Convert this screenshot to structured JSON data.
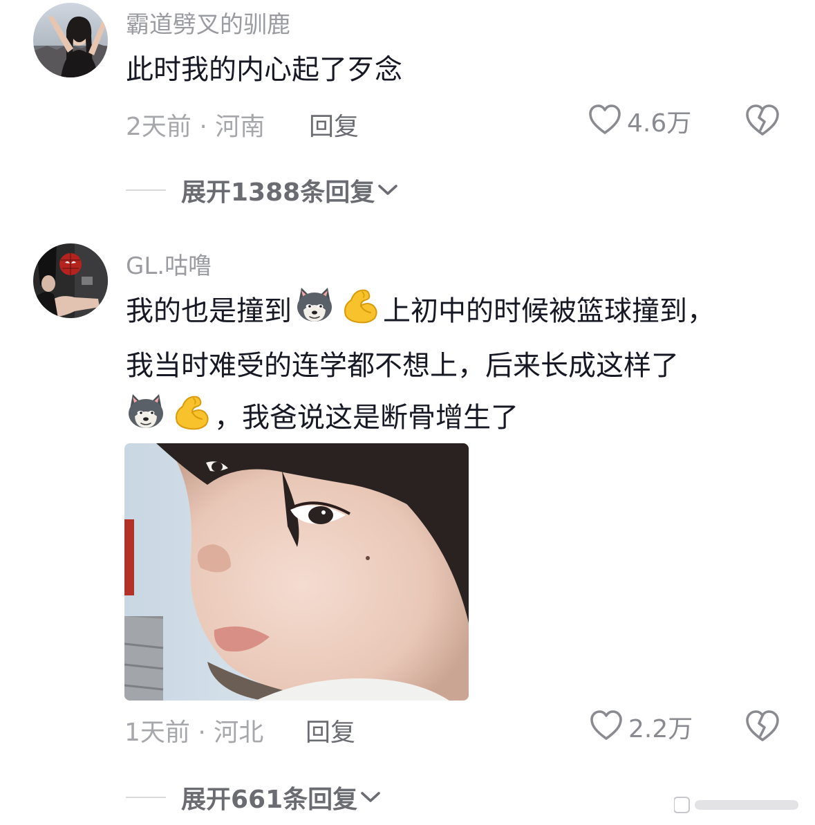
{
  "comments": [
    {
      "username": "霸道劈叉的驯鹿",
      "text_lines": [
        "此时我的内心起了歹念"
      ],
      "time_location": "2天前 · 河南",
      "reply_label": "回复",
      "like_count": "4.6万",
      "expand_label": "展开1388条回复"
    },
    {
      "username": "GL.咕噜",
      "text_line1_before": "我的也是撞到",
      "text_line1_after": "上初中的时候被篮球撞到，",
      "text_line2": "我当时难受的连学都不想上，后来长成这样了",
      "text_line3_after": "，我爸说这是断骨增生了",
      "emojis": [
        "doge-icon",
        "flexed-biceps-icon"
      ],
      "time_location": "1天前 · 河北",
      "reply_label": "回复",
      "like_count": "2.2万",
      "expand_label": "展开661条回复"
    }
  ],
  "colors": {
    "username": "#9a9ba0",
    "body_text": "#161823",
    "meta_text": "#a6a7ab",
    "action_text": "#6b6c72"
  }
}
